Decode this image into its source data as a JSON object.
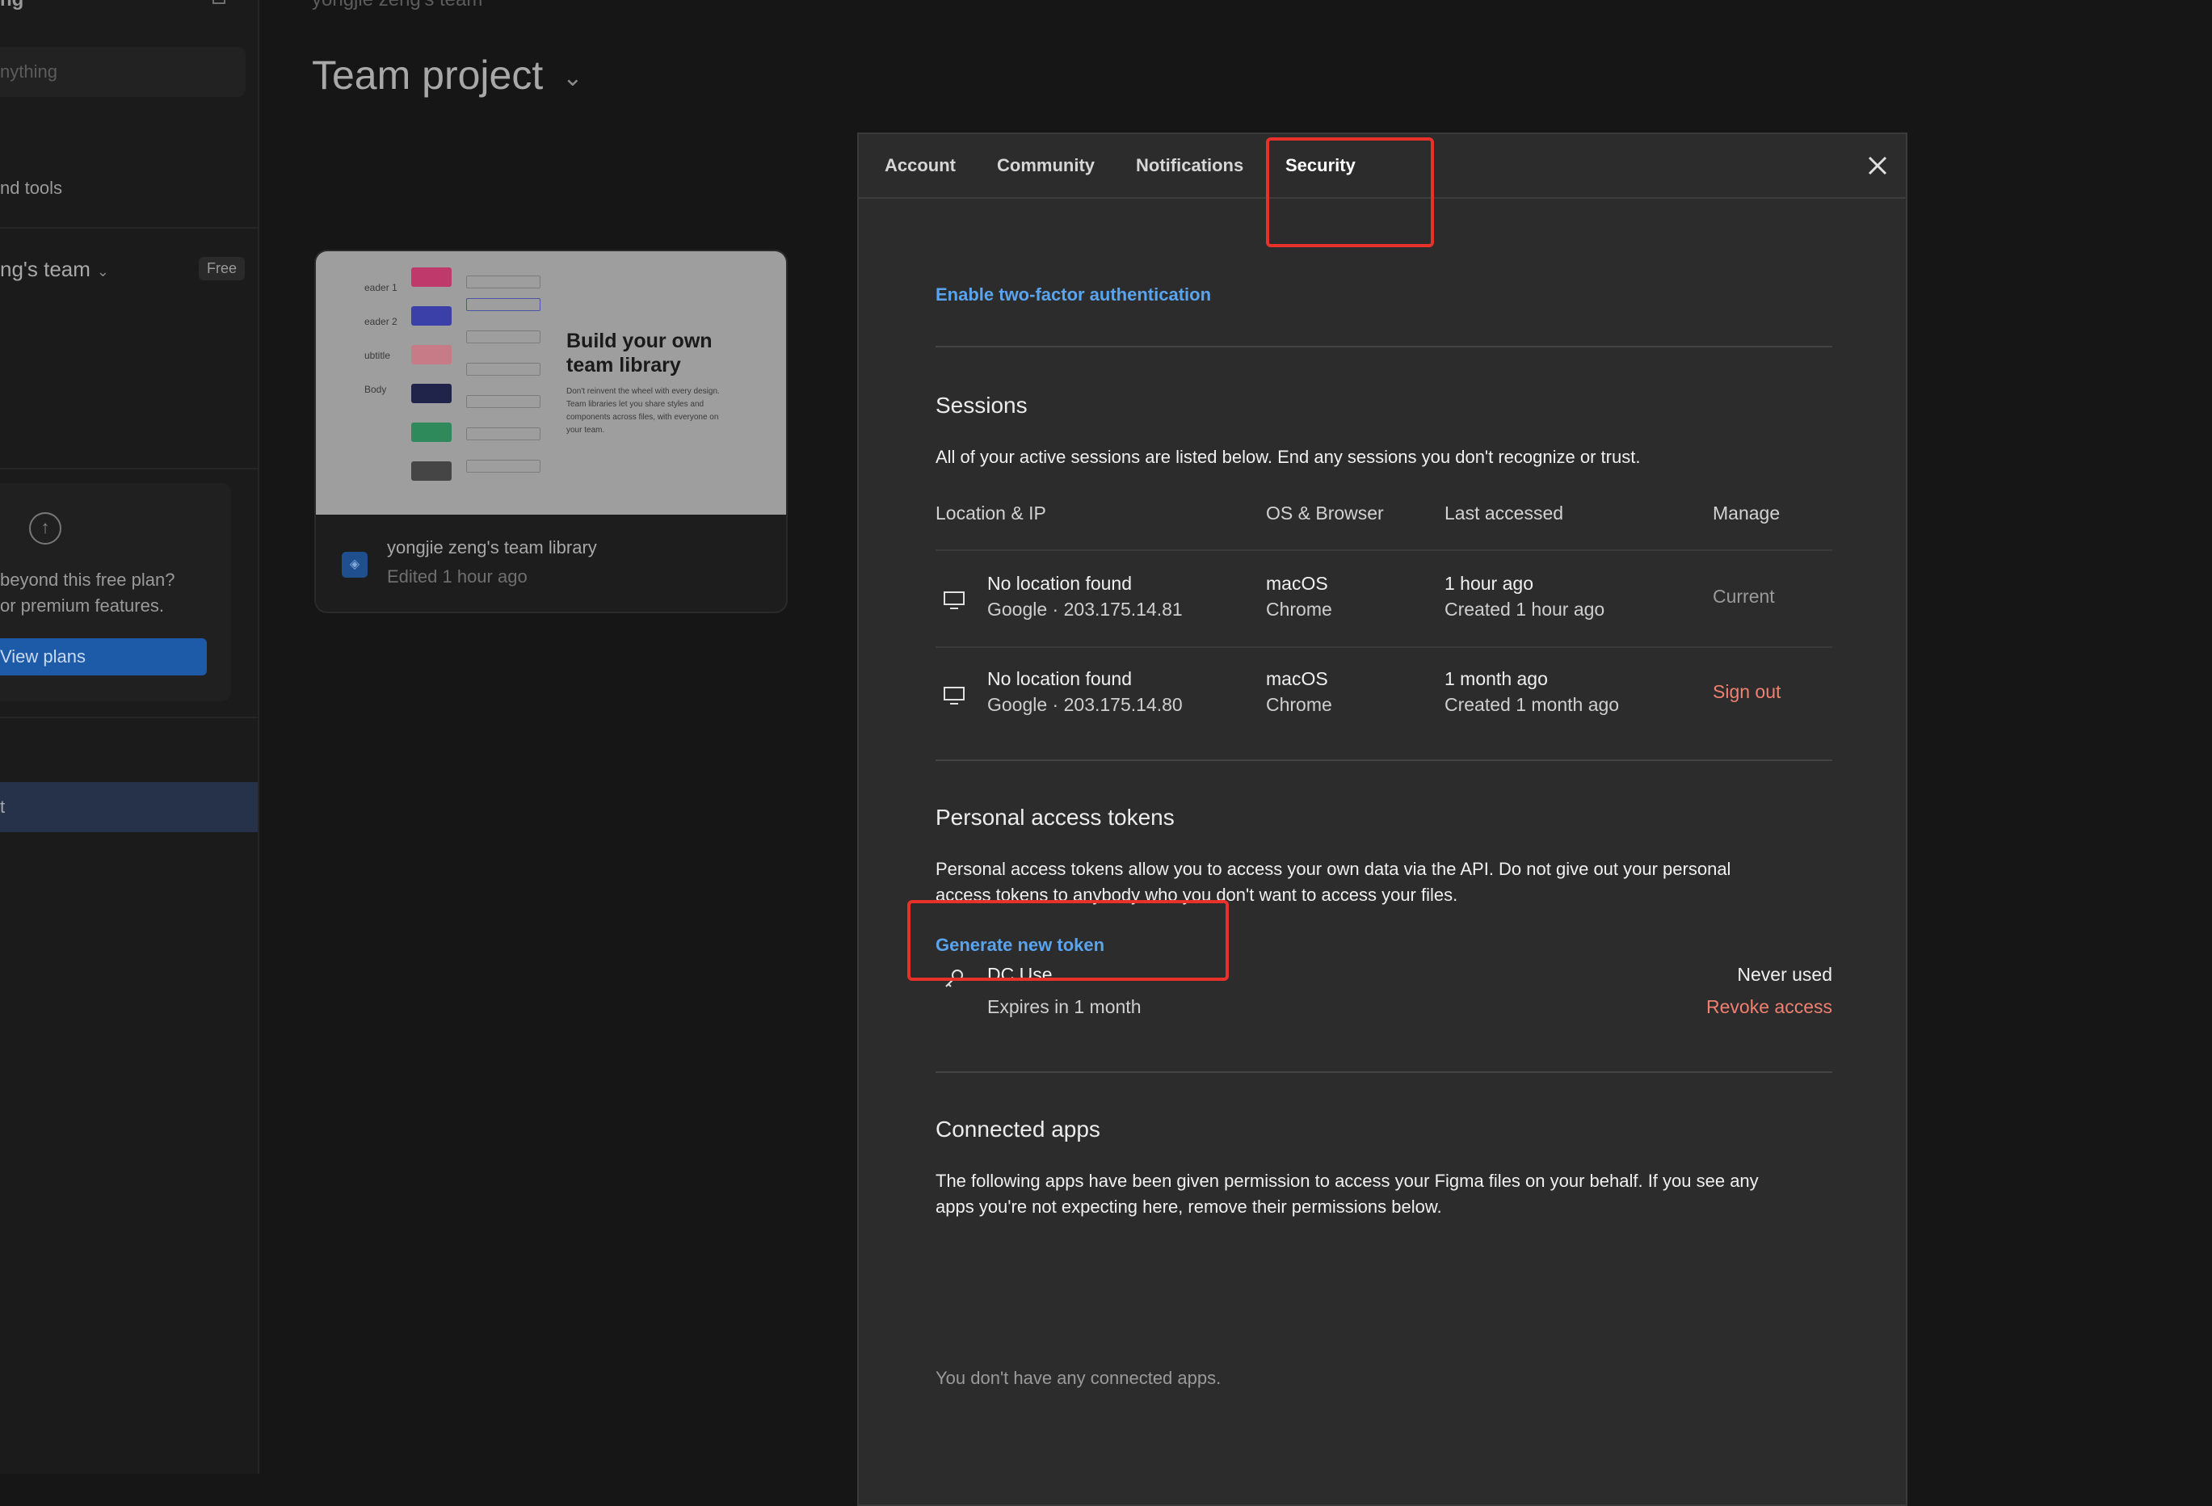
{
  "sidebar": {
    "top_title": "ng",
    "search_placeholder": "nything",
    "tools_label": "nd tools",
    "team_name": "ng's team",
    "team_chevron": "⌄",
    "plan_badge": "Free",
    "upgrade_line1": " beyond this free plan?",
    "upgrade_line2": "or premium features.",
    "view_plans_label": "View plans",
    "active_item_label": "t"
  },
  "main": {
    "breadcrumb": "yongjie zeng's team",
    "title": "Team project",
    "card": {
      "thumb_rows": [
        "eader 1",
        "eader 2",
        "ubtitle",
        "Body",
        "",
        "",
        "",
        ""
      ],
      "thumb_heading": "Build your own team library",
      "thumb_body": "Don't reinvent the wheel with every design. Team libraries let you share styles and components across files, with everyone on your team.",
      "name": "yongjie zeng's team library",
      "edited": "Edited 1 hour ago"
    }
  },
  "modal": {
    "tabs": [
      {
        "label": "Account"
      },
      {
        "label": "Community"
      },
      {
        "label": "Notifications"
      },
      {
        "label": "Security"
      }
    ],
    "active_tab": "Security",
    "two_factor_link": "Enable two-factor authentication",
    "sessions": {
      "heading": "Sessions",
      "description": "All of your active sessions are listed below. End any sessions you don't recognize or trust.",
      "columns": [
        "Location & IP",
        "OS & Browser",
        "Last accessed",
        "Manage"
      ],
      "rows": [
        {
          "location": "No location found",
          "ip": "Google · 203.175.14.81",
          "os": "macOS",
          "browser": "Chrome",
          "last": "1 hour ago",
          "created": "Created 1 hour ago",
          "manage": "Current"
        },
        {
          "location": "No location found",
          "ip": "Google · 203.175.14.80",
          "os": "macOS",
          "browser": "Chrome",
          "last": "1 month ago",
          "created": "Created 1 month ago",
          "manage": "Sign out"
        }
      ]
    },
    "tokens": {
      "heading": "Personal access tokens",
      "description_line1": "Personal access tokens allow you to access your own data via the API. Do not give out your personal",
      "description_line2": "access tokens to anybody who you don't want to access your files.",
      "generate_link": "Generate new token",
      "items": [
        {
          "name": "DC Use",
          "expires": "Expires in 1 month",
          "usage": "Never used",
          "action": "Revoke access"
        }
      ]
    },
    "apps": {
      "heading": "Connected apps",
      "description_line1": "The following apps have been given permission to access your Figma files on your behalf. If you see any",
      "description_line2": "apps you're not expecting here, remove their permissions below.",
      "empty_text": "You don't have any connected apps."
    }
  },
  "colors": {
    "link": "#5aa4ee",
    "danger": "#f0806f",
    "highlight": "#e8312a",
    "modal_bg": "#2c2c2c"
  },
  "icons": [
    "bell-icon",
    "chevron-down-icon",
    "arrow-up-circle-icon",
    "close-icon",
    "monitor-icon",
    "key-icon",
    "library-icon"
  ]
}
